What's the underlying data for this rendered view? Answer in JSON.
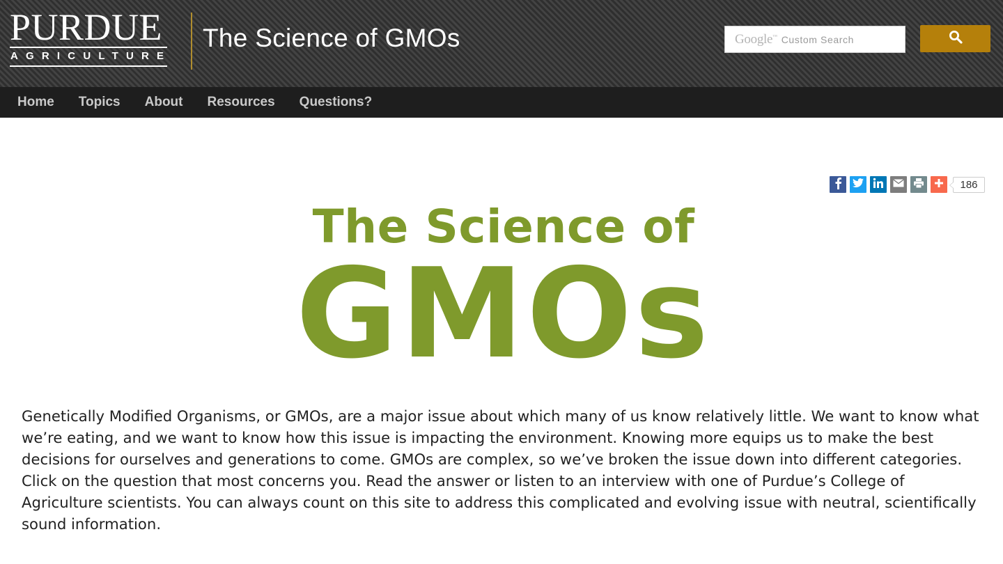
{
  "header": {
    "logo": {
      "wordmark": "PURDUE",
      "subline": "AGRICULTURE"
    },
    "site_title": "The Science of GMOs",
    "search": {
      "brand": "Google",
      "brand_tm": "™",
      "placeholder": "Custom Search"
    },
    "search_button_icon": "search-icon"
  },
  "nav": {
    "items": [
      {
        "label": "Home"
      },
      {
        "label": "Topics"
      },
      {
        "label": "About"
      },
      {
        "label": "Resources"
      },
      {
        "label": "Questions?"
      }
    ]
  },
  "share": {
    "buttons": [
      {
        "icon": "facebook-icon",
        "color": "#3b5998"
      },
      {
        "icon": "twitter-icon",
        "color": "#1da1f2"
      },
      {
        "icon": "linkedin-icon",
        "color": "#0077b5"
      },
      {
        "icon": "email-icon",
        "color": "#7d7d7d"
      },
      {
        "icon": "print-icon",
        "color": "#738a8d"
      },
      {
        "icon": "plus-icon",
        "color": "#f8694d"
      }
    ],
    "count": "186"
  },
  "hero": {
    "line1": "The Science of",
    "line2": "GMOs"
  },
  "intro": {
    "text": "Genetically Modified Organisms, or GMOs, are a major issue about which many of us know relatively little. We want to know what we’re eating, and we want to know how this issue is impacting the environment. Knowing more equips us to make the best decisions for ourselves and generations to come. GMOs are complex, so we’ve broken the issue down into different categories. Click on the question that most concerns you. Read the answer or listen to an interview with one of Purdue’s College of Agriculture scientists. You can always count on this site to address this complicated and evolving issue with neutral, scientifically sound information."
  },
  "colors": {
    "brand_gold": "#b5800b",
    "hero_green": "#7f9a2c",
    "nav_bg": "#1e1e1e"
  }
}
